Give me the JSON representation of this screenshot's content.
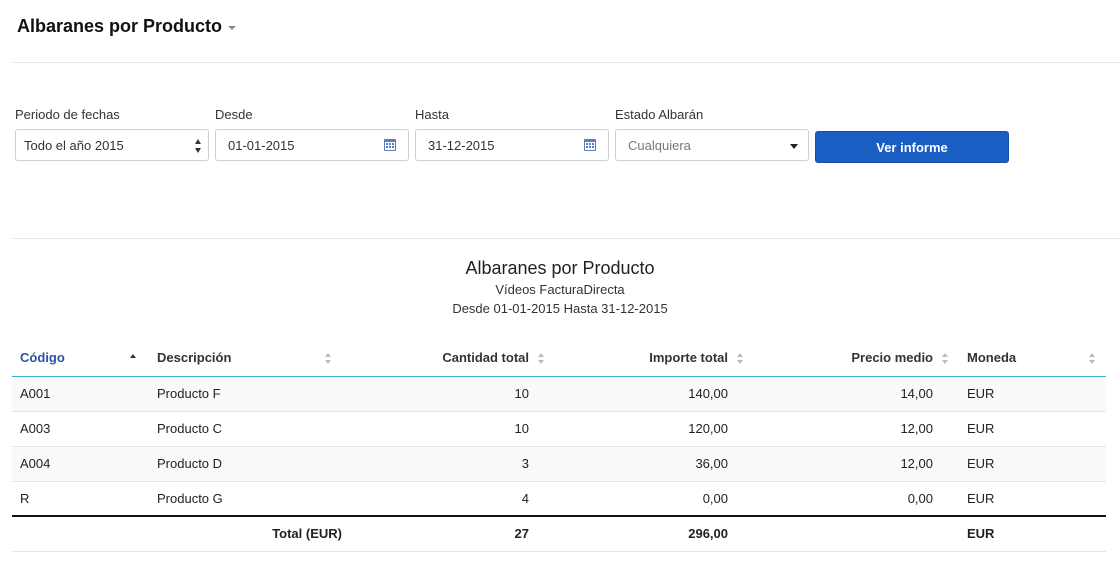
{
  "header": {
    "title": "Albaranes por Producto"
  },
  "filters": {
    "period": {
      "label": "Periodo de fechas",
      "value": "Todo el año 2015"
    },
    "from": {
      "label": "Desde",
      "value": "01-01-2015"
    },
    "to": {
      "label": "Hasta",
      "value": "31-12-2015"
    },
    "status": {
      "label": "Estado Albarán",
      "value": "Cualquiera"
    },
    "submit_label": "Ver informe"
  },
  "report": {
    "title": "Albaranes por Producto",
    "company": "Vídeos FacturaDirecta",
    "range": "Desde 01-01-2015 Hasta 31-12-2015",
    "columns": [
      "Código",
      "Descripción",
      "Cantidad total",
      "Importe total",
      "Precio medio",
      "Moneda"
    ],
    "rows": [
      [
        "A001",
        "Producto F",
        "10",
        "140,00",
        "14,00",
        "EUR"
      ],
      [
        "A003",
        "Producto C",
        "10",
        "120,00",
        "12,00",
        "EUR"
      ],
      [
        "A004",
        "Producto D",
        "3",
        "36,00",
        "12,00",
        "EUR"
      ],
      [
        "R",
        "Producto G",
        "4",
        "0,00",
        "0,00",
        "EUR"
      ]
    ],
    "total": {
      "label": "Total (EUR)",
      "quantity": "27",
      "amount": "296,00",
      "currency": "EUR"
    }
  },
  "colors": {
    "accent": "#1a5ec4",
    "active_sort": "#2a52a8",
    "header_rule": "#3bb0d6"
  }
}
